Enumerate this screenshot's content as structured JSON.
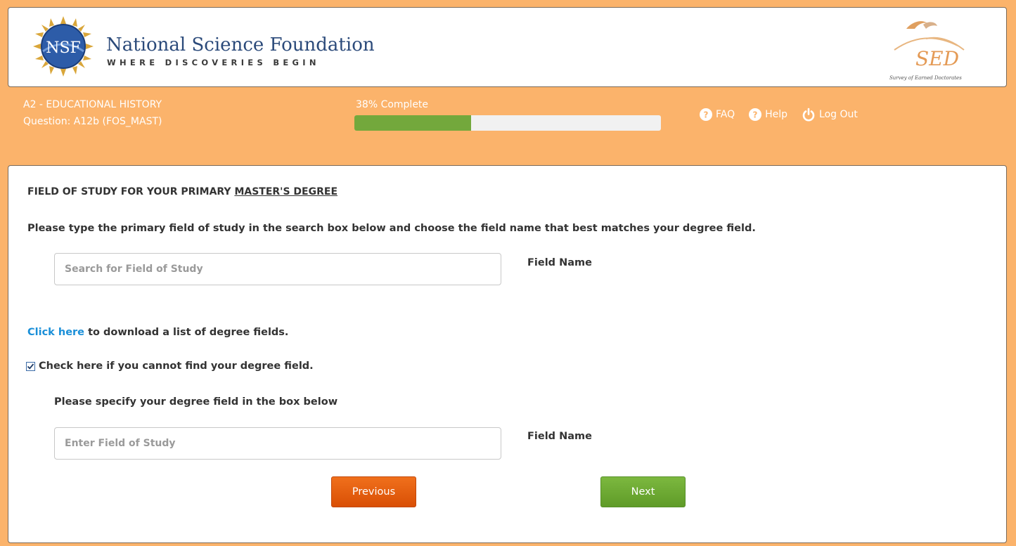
{
  "header": {
    "org_name": "National Science Foundation",
    "tagline": "WHERE DISCOVERIES BEGIN",
    "seal_text": "NSF",
    "sed_logo_text": "SED",
    "sed_logo_subtitle": "Survey of Earned Doctorates"
  },
  "status": {
    "section": "A2 - EDUCATIONAL HISTORY",
    "question": "Question: A12b (FOS_MAST)",
    "progress_label": "38% Complete",
    "progress_percent": 38
  },
  "nav": {
    "faq": "FAQ",
    "help": "Help",
    "logout": "Log Out"
  },
  "question": {
    "heading_prefix": "FIELD OF STUDY FOR YOUR PRIMARY ",
    "heading_emphasis": "MASTER'S DEGREE",
    "instructions": "Please type the primary field of study in the search box below and choose the field name that best matches your degree field.",
    "search_placeholder": "Search for Field of Study",
    "search_value": "",
    "field_name_label": "Field Name",
    "download_link": "Click here",
    "download_text": " to download a list of degree fields.",
    "checkbox_label": "Check here if you cannot find your degree field.",
    "checkbox_checked": true,
    "specify_prompt": "Please specify your degree field in the box below",
    "specify_placeholder": "Enter Field of Study",
    "specify_value": "",
    "field_name_label_2": "Field Name"
  },
  "buttons": {
    "previous": "Previous",
    "next": "Next"
  },
  "colors": {
    "page_bg": "#fbb36b",
    "progress_fill": "#73a83c",
    "link": "#1a8fd8",
    "previous_button": "#e2580b",
    "next_button": "#6eab34"
  },
  "icons": {
    "faq": "question-circle-icon",
    "help": "question-circle-icon",
    "logout": "power-icon"
  }
}
